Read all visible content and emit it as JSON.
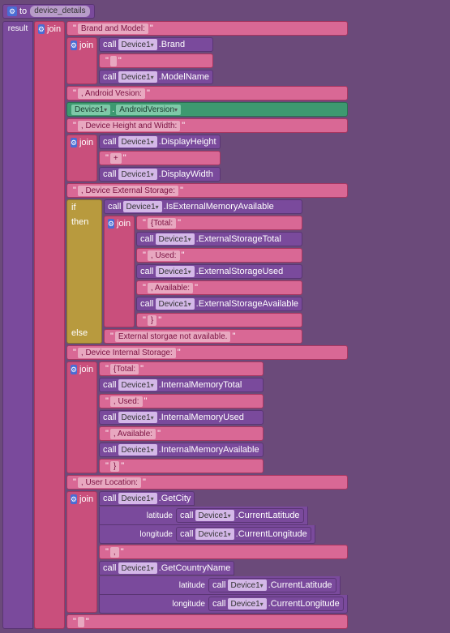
{
  "header": {
    "to": "to",
    "var": "device_details",
    "result": "result"
  },
  "join": "join",
  "call": "call",
  "device": "Device1",
  "if": "if",
  "then": "then",
  "else": "else",
  "dot": ".",
  "labels": {
    "brand_model": "Brand and Model: ",
    "brand": ".Brand",
    "space": " ",
    "modelname": ".ModelName",
    "android_version_lbl": ", Android Vesion: ",
    "android_version_prop": "AndroidVersion",
    "hw_lbl": ", Device Height and Width: ",
    "disp_h": ".DisplayHeight",
    "plus": " + ",
    "disp_w": ".DisplayWidth",
    "ext_lbl": ", Device External Storage: ",
    "is_ext": ".IsExternalMemoryAvailable",
    "total_open": " {Total: ",
    "ext_total": ".ExternalStorageTotal",
    "used_lbl": " , Used: ",
    "ext_used": ".ExternalStorageUsed",
    "avail_lbl": " , Available: ",
    "ext_avail": ".ExternalStorageAvailable",
    "close_brace": " } ",
    "ext_na": " External storgae not available. ",
    "int_lbl": ", Device Internal Storage: ",
    "int_total": ".InternalMemoryTotal",
    "int_used": ".InternalMemoryUsed",
    "int_avail": ".InternalMemoryAvailable",
    "loc_lbl": " , User Location: ",
    "getcity": ".GetCity",
    "lat": "latitude",
    "lon": "longitude",
    "cur_lat": ".CurrentLatitude",
    "cur_lon": ".CurrentLongitude",
    "comma": " , ",
    "getcountry": ".GetCountryName",
    "empty": " "
  }
}
